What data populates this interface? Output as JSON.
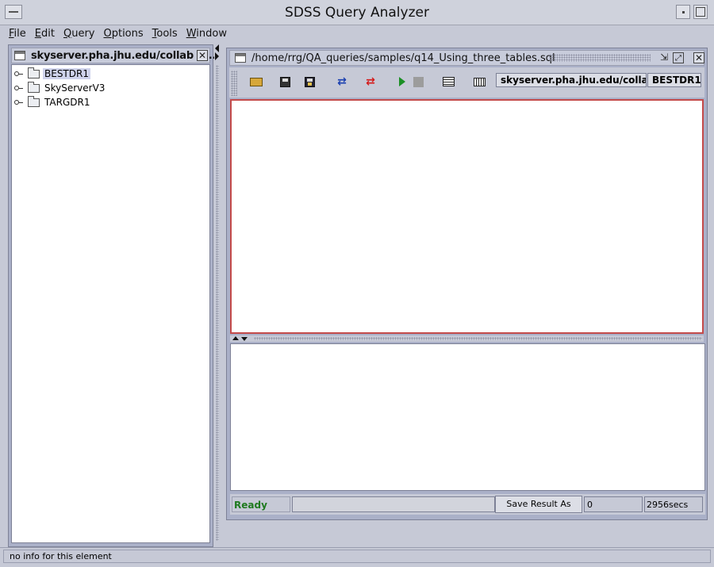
{
  "window": {
    "title": "SDSS Query Analyzer"
  },
  "menu": {
    "items": [
      "File",
      "Edit",
      "Query",
      "Options",
      "Tools",
      "Window"
    ]
  },
  "left_frame": {
    "title": "skyserver.pha.jhu.edu/collab B...",
    "tree": [
      {
        "label": "BESTDR1",
        "selected": true
      },
      {
        "label": "SkyServerV3",
        "selected": false
      },
      {
        "label": "TARGDR1",
        "selected": false
      }
    ]
  },
  "query_frame": {
    "title": "/home/rrg/QA_queries/samples/q14_Using_three_tables.sql",
    "toolbar": {
      "icons": [
        "open-folder-icon",
        "save-icon",
        "save-as-icon",
        "undo-icon",
        "redo-icon",
        "run-icon",
        "stop-icon",
        "grid-view-icon",
        "table-view-icon"
      ],
      "server": "skyserver.pha.jhu.edu/collab",
      "database": "BESTDR1"
    },
    "editor_text": "",
    "status": {
      "state": "Ready",
      "save_button": "Save Result As",
      "row_count": "0",
      "elapsed": "2956secs"
    }
  },
  "statusbar": {
    "text": "no info for this element"
  },
  "colors": {
    "ready_text": "#1f7a1f",
    "editor_border": "#c34a4a",
    "undo_arrow": "#1a3fb0",
    "redo_arrow": "#d41a1a",
    "run_icon": "#1b8f25"
  }
}
